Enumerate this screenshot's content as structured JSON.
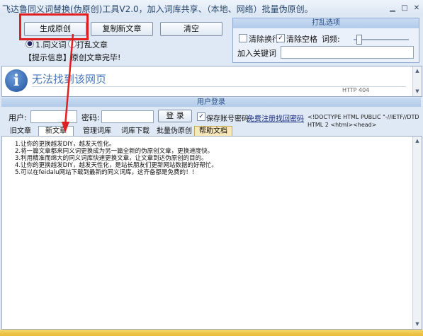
{
  "window": {
    "title": "飞达鲁同义词替换(伪原创)工具V2.0，加入词库共享、（本地、网络）批量伪原创。",
    "controls": [
      "minimize-icon",
      "maximize-icon",
      "close-icon"
    ]
  },
  "toolbar": {
    "generate_label": "生成原创",
    "copy_label": "复制新文章",
    "clear_label": "清空",
    "radio_1_label": "1.同义词",
    "radio_2_label": "打乱文章",
    "tip_text": "【提示信息】原创文章完毕!"
  },
  "shuffle": {
    "title": "打乱选项",
    "clear_newline_label": "清除换行",
    "clear_newline_checked": false,
    "clear_space_label": "清除空格",
    "clear_space_checked": true,
    "frequency_label": "词频:",
    "keyword_label": "加入关键词",
    "keyword_value": ""
  },
  "browser": {
    "message": "无法找到该网页",
    "code": "HTTP 404",
    "icon": "info-icon"
  },
  "login": {
    "title": "用户登录",
    "user_label": "用户:",
    "user_value": "",
    "password_label": "密码:",
    "password_value": "",
    "login_label": "登 录",
    "save_label": "保存账号密码",
    "save_checked": true,
    "register_label": "免费注册",
    "forgot_label": "找回密码",
    "html_snippet": "<!DOCTYPE HTML PUBLIC \"-//IETF//DTD HTML 2 <html><head>"
  },
  "tabs": [
    {
      "label": "旧文章",
      "active": false
    },
    {
      "label": "新文章",
      "active": true
    },
    {
      "label": "管理词库",
      "active": false
    },
    {
      "label": "词库下载",
      "active": false
    },
    {
      "label": "批量伪原创",
      "active": false
    },
    {
      "label": "帮助文档",
      "active": false
    }
  ],
  "content": {
    "lines": [
      "1.让你的更换越发DIY，越发天性化。",
      "2.将一篇文章都来同义词更换成为另一篇全新的伪原创文章，更换速度快。",
      "3.利用精准而绵大的同义词库快速更换文章，让文章到达伪原创的目的。",
      "4.让你的更换越发DIY，越发天性化，是站长朋友们更新网站数据的好帮忙。",
      "5.可以在feidalu网站下载到最新的同义词库，这齐备都是免费的！！"
    ]
  },
  "colors": {
    "annotation": "#e02020",
    "accent": "#4a77bb",
    "status": "#e7b935"
  }
}
